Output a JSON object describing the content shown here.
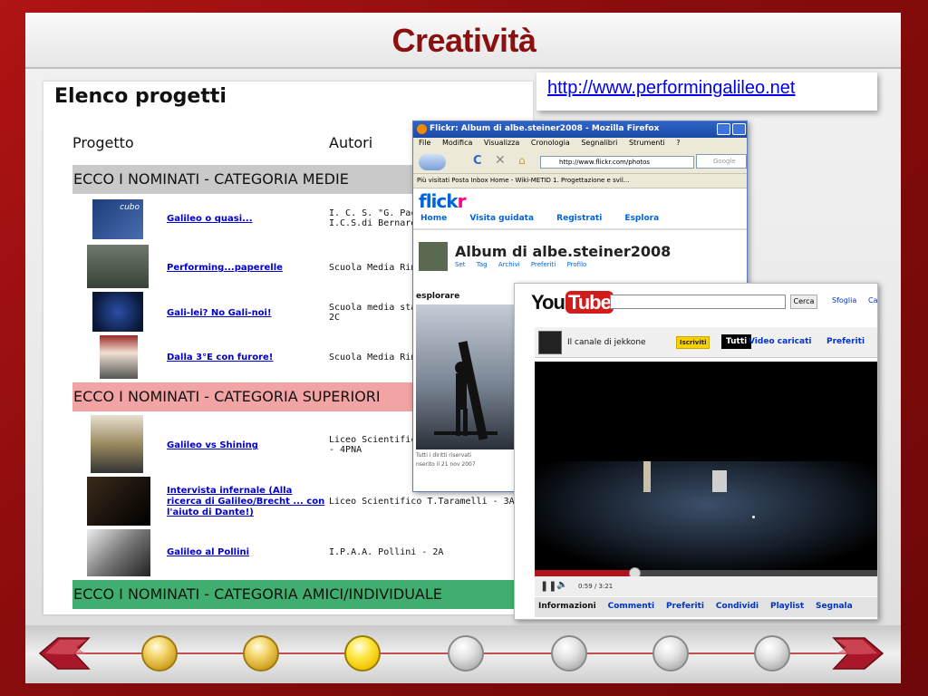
{
  "slide": {
    "title": "Creatività",
    "url": "http://www.performingalileo.net"
  },
  "doc": {
    "heading": "Elenco progetti",
    "col_progetto": "Progetto",
    "col_autori": "Autori",
    "cat_medie": "ECCO I NOMINATI - CATEGORIA MEDIE",
    "cat_superiori": "ECCO I NOMINATI - CATEGORIA SUPERIORI",
    "cat_amici": "ECCO I NOMINATI - CATEGORIA AMICI/INDIVIDUALE",
    "thumb_cubo_label": "cubo",
    "projects": [
      {
        "title": "Galileo o quasi...",
        "author1": "I. C. S. \"G. Paccin",
        "author2": "I.C.S.di Bernareg"
      },
      {
        "title": "Performing...paperelle",
        "author1": "Scuola Media Rin",
        "author2": ""
      },
      {
        "title": "Gali-lei? No Gali-noi!",
        "author1": "Scuola media sta",
        "author2": "2C"
      },
      {
        "title": "Dalla 3°E con furore!",
        "author1": "Scuola Media Rin",
        "author2": ""
      },
      {
        "title": "Galileo vs Shining",
        "author1": "Liceo Scientifico N",
        "author2": "- 4PNA"
      },
      {
        "title": "Intervista infernale (Alla ricerca di Galileo/Brecht ... con l'aiuto di Dante!)",
        "author1": "Liceo Scientifico T.Taramelli - 3AS",
        "author2": ""
      },
      {
        "title": "Galileo al Pollini",
        "author1": "I.P.A.A. Pollini - 2A",
        "author2": ""
      }
    ]
  },
  "flickr": {
    "window_title": "Flickr: Album di albe.steiner2008 - Mozilla Firefox",
    "menu": [
      "File",
      "Modifica",
      "Visualizza",
      "Cronologia",
      "Segnalibri",
      "Strumenti",
      "?"
    ],
    "url": "http://www.flickr.com/photos",
    "search_placeholder": "Google",
    "bookmarks": "Più visitati   Posta Inbox   Home - Wiki-METID   1. Progettazione e svil...",
    "logo_a": "flick",
    "logo_b": "r",
    "nav": [
      "Home",
      "Visita guidata",
      "Registrati",
      "Esplora"
    ],
    "album_title": "Album di albe.steiner2008",
    "sub_links": [
      "Set",
      "Tag",
      "Archivi",
      "Preferiti",
      "Profilo"
    ],
    "explore_label": "esplorare",
    "rights": "Tutti i diritti riservati",
    "date": "nserito il 21 nov 2007"
  },
  "youtube": {
    "logo_you": "You",
    "logo_tube": "Tube",
    "search_button": "Cerca",
    "top_links": [
      "Sfoglia",
      "Ca"
    ],
    "channel": "Il canale di jekkone",
    "subscribe": "Iscriviti",
    "tab_all": "Tutti",
    "tab_uploaded": "Video caricati",
    "tab_favs": "Preferiti",
    "time": "0:59 / 3:21",
    "progress_fraction": 0.29,
    "info_tabs": [
      "Informazioni",
      "Commenti",
      "Preferiti",
      "Condividi",
      "Playlist",
      "Segnala"
    ]
  },
  "colors": {
    "title": "#8b1010",
    "cat_medie": "#c9c9c9",
    "cat_superiori": "#f2a3a3",
    "cat_amici": "#3fae6e"
  }
}
